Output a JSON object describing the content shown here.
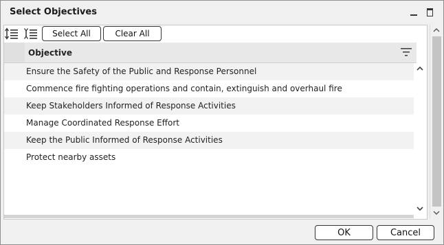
{
  "dialog": {
    "title": "Select Objectives"
  },
  "toolbar": {
    "select_all_label": "Select All",
    "clear_all_label": "Clear All"
  },
  "grid": {
    "column_header": "Objective",
    "rows": [
      "Ensure the Safety of the Public and Response Personnel",
      "Commence fire fighting operations and contain, extinguish and overhaul fire",
      "Keep Stakeholders Informed of Response Activities",
      "Manage Coordinated Response Effort",
      "Keep the Public Informed of Response Activities",
      "Protect nearby assets"
    ]
  },
  "footer": {
    "ok_label": "OK",
    "cancel_label": "Cancel"
  },
  "icons": {
    "minimize": "minimize-icon",
    "maximize": "maximize-icon",
    "expand_all": "expand-all-icon",
    "collapse_all": "collapse-all-icon",
    "filter": "filter-icon",
    "scroll_up": "chevron-up-icon",
    "scroll_down": "chevron-down-icon"
  },
  "colors": {
    "row_alt": "#f2f2f2",
    "header_bg": "#e8e8e8",
    "dialog_bg": "#f0f0f0"
  }
}
